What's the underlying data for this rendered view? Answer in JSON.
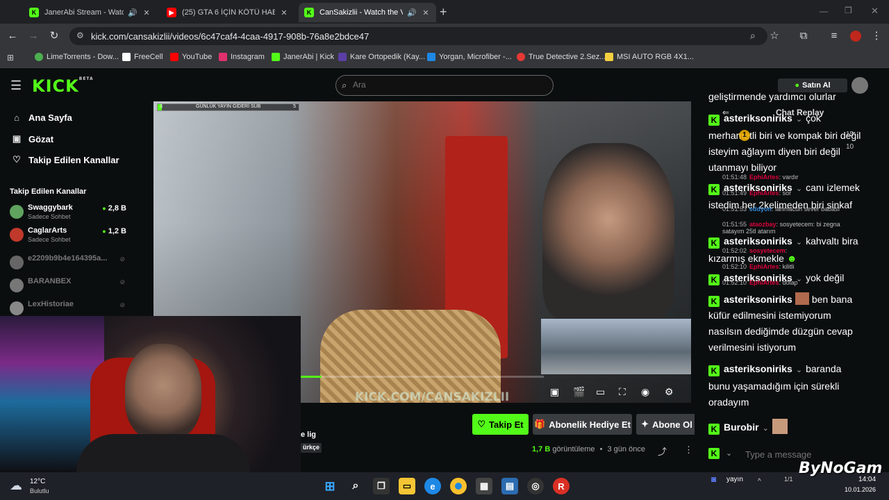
{
  "browser": {
    "tabs": [
      {
        "title": "JanerAbi Stream - Watch Live",
        "icon_color": "#53fc18",
        "icon_letter": "K"
      },
      {
        "title": "(25) GTA 6 İÇİN KÖTÜ HABER | ...",
        "icon_color": "#ff0000",
        "icon_letter": "▶"
      },
      {
        "title": "CanSakizlii - Watch the VOD",
        "icon_color": "#53fc18",
        "icon_letter": "K"
      }
    ],
    "url": "kick.com/cansakizlii/videos/6c47caf4-4caa-4917-908b-76a8e2bdce47",
    "bookmarks": [
      {
        "label": "LimeTorrents - Dow...",
        "color": "#4caf50"
      },
      {
        "label": "FreeCell",
        "color": "#ffffff"
      },
      {
        "label": "YouTube",
        "color": "#ff0000"
      },
      {
        "label": "Instagram",
        "color": "#e1306c"
      },
      {
        "label": "JanerAbi | Kick",
        "color": "#53fc18"
      },
      {
        "label": "Kare Ortopedik (Kay...",
        "color": "#5b3fa6"
      },
      {
        "label": "Yorgan, Microfiber -...",
        "color": "#1e88e5"
      },
      {
        "label": "True Detective 2.Sez...",
        "color": "#e53935"
      },
      {
        "label": "MSI AUTO RGB 4X1...",
        "color": "#f4d03f"
      }
    ]
  },
  "kick": {
    "logo": "KICK",
    "logo_beta": "BETA",
    "search_placeholder": "Ara",
    "nav": [
      {
        "label": "Ana Sayfa",
        "icon": "home-icon"
      },
      {
        "label": "Gözat",
        "icon": "browse-icon"
      },
      {
        "label": "Takip Edilen Kanallar",
        "icon": "heart-icon"
      }
    ],
    "followed_title": "Takip Edilen Kanallar",
    "followed": [
      {
        "name": "Swaggybark",
        "sub": "Sadece Sohbet",
        "viewers": "2,8 B",
        "live": true,
        "color": "#5fa35f"
      },
      {
        "name": "CaglarArts",
        "sub": "Sadece Sohbet",
        "viewers": "1,2 B",
        "live": true,
        "color": "#c0392b"
      },
      {
        "name": "e2209b9b4e164395a...",
        "sub": "",
        "viewers": "",
        "live": false,
        "color": "#666666"
      },
      {
        "name": "BARANBEX",
        "sub": "",
        "viewers": "",
        "live": false,
        "color": "#777777"
      },
      {
        "name": "LexHistoriae",
        "sub": "",
        "viewers": "",
        "live": false,
        "color": "#888888"
      }
    ],
    "buy_label": "Satın Al",
    "video": {
      "watermark": "KICK.COM/CANSAKIZLII",
      "goal_label": "GÜNLÜK YAYIN GİDERİ SUB",
      "goal_left": "3",
      "goal_right": "5",
      "progress": 0.03
    },
    "stream_title_fragment": "e lig",
    "stream_language_fragment": "ürkçe",
    "actions": {
      "follow": "Takip Et",
      "gift": "Abonelik Hediye Et",
      "subscribe": "Abone Ol"
    },
    "views_count": "1,7 B",
    "views_label": "görüntüleme",
    "age": "3 gün önce",
    "chat_replay": "Chat Replay",
    "chat_input_placeholder": "Type a message",
    "chat": [
      {
        "user": "",
        "text": "geliştirmende yardımcı olurlar"
      },
      {
        "user": "asteriksoniriks",
        "text": "çok merhametli biri ve kompak biri değil isteyim ağlayım diyen biri değil utanmayı biliyor"
      },
      {
        "user": "asteriksoniriks",
        "text": "canı izlemek istedim her 2kelimeden biri sinkaf"
      },
      {
        "user": "asteriksoniriks",
        "text": "kahvaltı bira kızarmış ekmekle"
      },
      {
        "user": "asteriksoniriks",
        "text": "yok değil"
      },
      {
        "user": "asteriksoniriks",
        "text": "ben bana küfür edilmesini istemiyorum nasılsın dediğimde düzgün cevap verilmesini istiyorum"
      },
      {
        "user": "asteriksoniriks",
        "text": "baranda bunu yaşamadığım için sürekli oradayım"
      },
      {
        "user": "Burobir",
        "text": ""
      }
    ],
    "replay_overlay": [
      {
        "ts": "01:51:48",
        "user": "EphiArtes",
        "msg": "vardır"
      },
      {
        "ts": "01:51:49",
        "user": "EphiArtes",
        "msg": "sor"
      },
      {
        "ts": "01:51:53",
        "user": "eddyon",
        "msg": "lahmacun sever babası"
      },
      {
        "ts": "01:51:55",
        "user": "ataozbay",
        "msg": "sosyetecem: bi zegna satayım 25tl atarım"
      },
      {
        "ts": "01:52:02",
        "user": "sosyetecem",
        "msg": ""
      },
      {
        "ts": "01:52:10",
        "user": "EphiArtes",
        "msg": "kilitli"
      },
      {
        "ts": "01:52:10",
        "user": "EphiArtes",
        "msg": "dolap"
      }
    ],
    "overlay_counts": [
      "15",
      "10"
    ]
  },
  "taskbar": {
    "weather_temp": "12°C",
    "weather_desc": "Bulutlu",
    "search_label": "yayın",
    "time": "14:04",
    "date": "10.01.2026",
    "page": "1/1"
  },
  "watermark": "ByNoGam"
}
